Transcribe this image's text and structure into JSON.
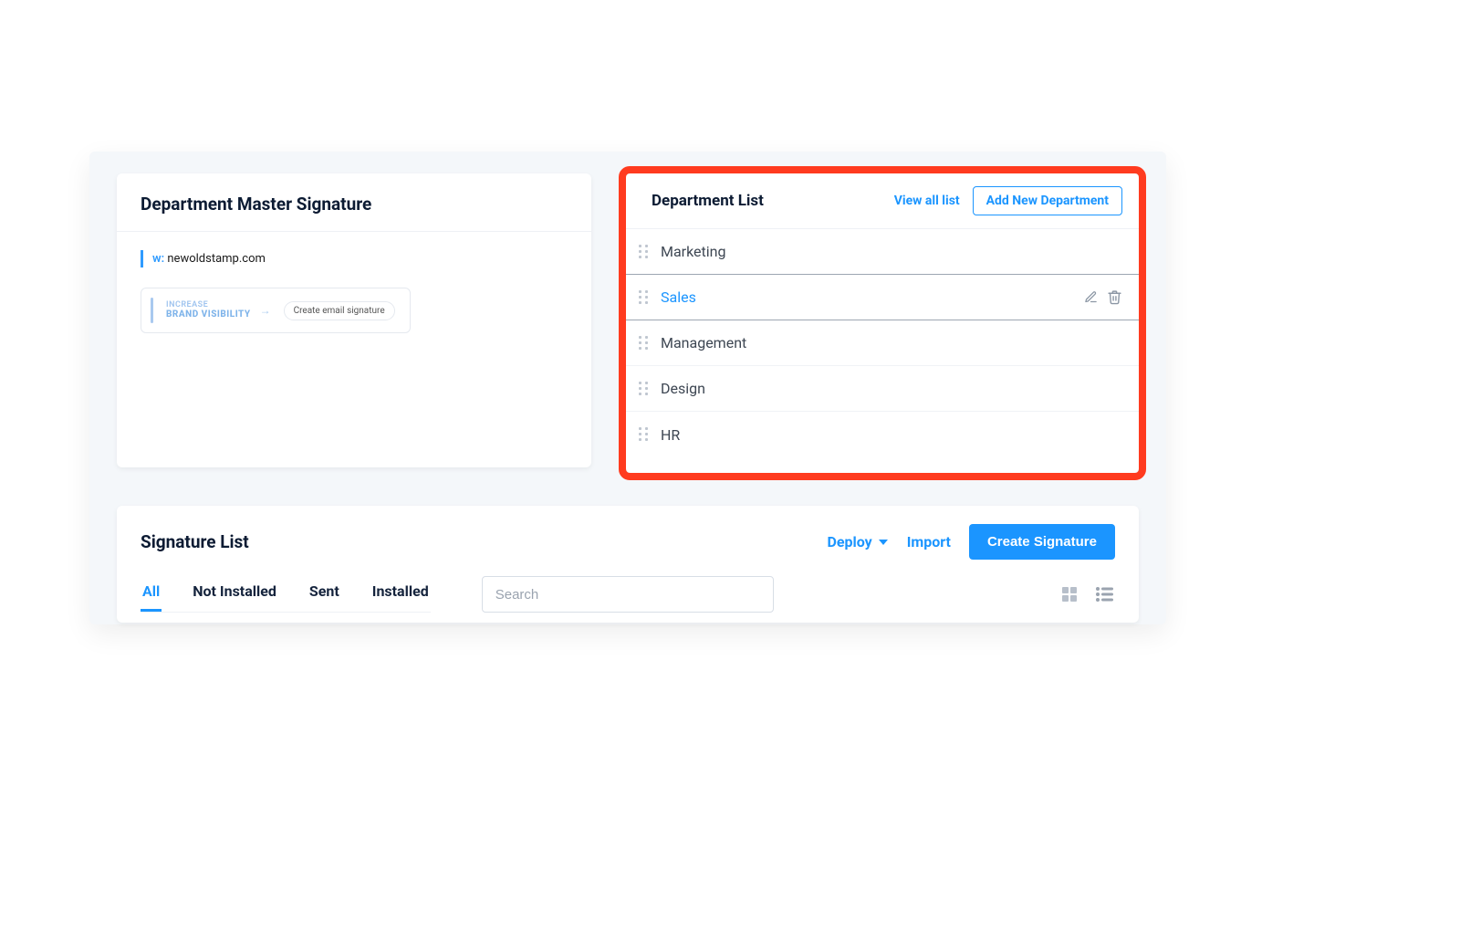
{
  "master": {
    "title": "Department Master Signature",
    "website_prefix": "w:",
    "website": "newoldstamp.com",
    "banner_line1": "INCREASE",
    "banner_line2": "BRAND VISIBILITY",
    "banner_cta": "Create email signature"
  },
  "departments": {
    "title": "Department List",
    "view_all": "View all list",
    "add_new": "Add New Department",
    "items": [
      {
        "name": "Marketing",
        "active": false
      },
      {
        "name": "Sales",
        "active": true
      },
      {
        "name": "Management",
        "active": false
      },
      {
        "name": "Design",
        "active": false
      },
      {
        "name": "HR",
        "active": false
      }
    ]
  },
  "siglist": {
    "title": "Signature List",
    "deploy": "Deploy",
    "import": "Import",
    "create": "Create Signature",
    "tabs": {
      "all": "All",
      "not_installed": "Not Installed",
      "sent": "Sent",
      "installed": "Installed"
    },
    "search_placeholder": "Search"
  }
}
